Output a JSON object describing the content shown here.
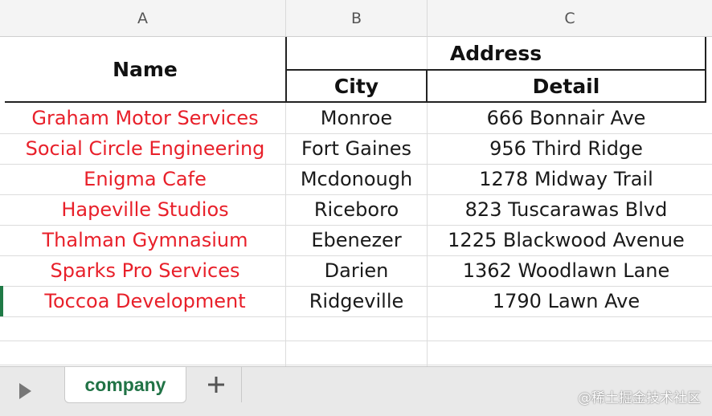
{
  "columns": [
    "A",
    "B",
    "C"
  ],
  "headers": {
    "name": "Name",
    "address": "Address",
    "city": "City",
    "detail": "Detail"
  },
  "rows": [
    {
      "name": "Graham Motor Services",
      "city": "Monroe",
      "detail": "666 Bonnair Ave"
    },
    {
      "name": "Social Circle Engineering",
      "city": "Fort Gaines",
      "detail": "956 Third Ridge"
    },
    {
      "name": "Enigma Cafe",
      "city": "Mcdonough",
      "detail": "1278 Midway Trail"
    },
    {
      "name": "Hapeville Studios",
      "city": "Riceboro",
      "detail": "823 Tuscarawas Blvd"
    },
    {
      "name": "Thalman Gymnasium",
      "city": "Ebenezer",
      "detail": "1225 Blackwood Avenue"
    },
    {
      "name": "Sparks Pro Services",
      "city": "Darien",
      "detail": "1362 Woodlawn Lane"
    },
    {
      "name": "Toccoa Development",
      "city": "Ridgeville",
      "detail": "1790 Lawn Ave"
    }
  ],
  "tabs": [
    {
      "label": "company",
      "active": true
    }
  ],
  "add_sheet_icon": "plus-icon",
  "nav_icon": "play-right-icon",
  "watermark": "@稀土掘金技术社区",
  "colors": {
    "name_text": "#e8202a",
    "tab_text": "#217346",
    "selection_marker": "#1f7a46"
  }
}
